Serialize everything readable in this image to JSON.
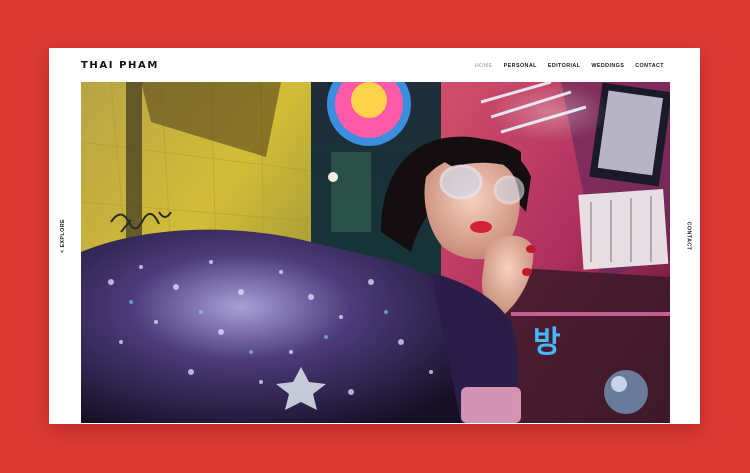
{
  "site": {
    "logo": "THAI PHAM"
  },
  "nav": {
    "items": [
      {
        "label": "HOME",
        "active": true
      },
      {
        "label": "PERSONAL",
        "active": false
      },
      {
        "label": "EDITORIAL",
        "active": false
      },
      {
        "label": "WEDDINGS",
        "active": false
      },
      {
        "label": "CONTACT",
        "active": false
      }
    ]
  },
  "side": {
    "left_label": "< EXPLORE",
    "right_label": "CONTACT"
  },
  "hero": {
    "sign_text": "방"
  },
  "colors": {
    "page_background": "#dc3b34",
    "card_background": "#ffffff",
    "nav_active": "#9a9a9a"
  }
}
